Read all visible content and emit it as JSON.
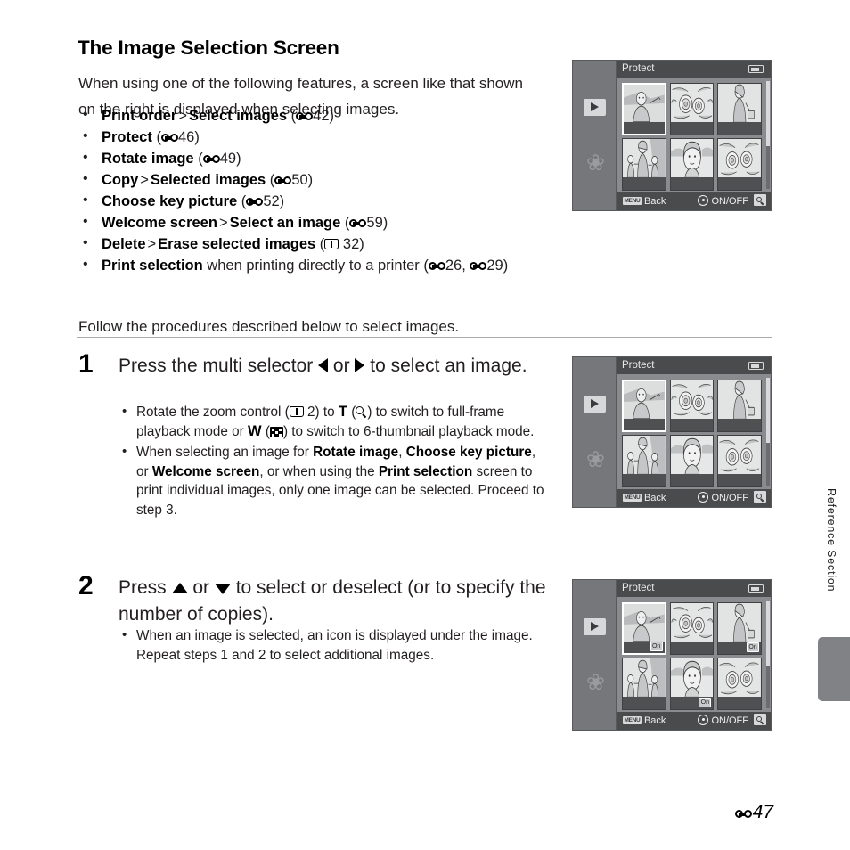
{
  "heading": "The Image Selection Screen",
  "intro": "When using one of the following features, a screen like that shown on the right is displayed when selecting images.",
  "bullets": [
    {
      "bold1": "Print order",
      "sep": ">",
      "bold2": "Select images",
      "ref_icon": "dumbbell-icon",
      "ref": "42"
    },
    {
      "bold1": "Protect",
      "sep": "",
      "bold2": "",
      "ref_icon": "dumbbell-icon",
      "ref": "46"
    },
    {
      "bold1": "Rotate image",
      "sep": "",
      "bold2": "",
      "ref_icon": "dumbbell-icon",
      "ref": "49"
    },
    {
      "bold1": "Copy",
      "sep": ">",
      "bold2": "Selected images",
      "ref_icon": "dumbbell-icon",
      "ref": "50"
    },
    {
      "bold1": "Choose key picture",
      "sep": "",
      "bold2": "",
      "ref_icon": "dumbbell-icon",
      "ref": "52"
    },
    {
      "bold1": "Welcome screen",
      "sep": ">",
      "bold2": "Select an image",
      "ref_icon": "dumbbell-icon",
      "ref": "59"
    },
    {
      "bold1": "Delete",
      "sep": ">",
      "bold2": "Erase selected images",
      "ref_icon": "book-icon",
      "ref": "32"
    },
    {
      "bold1": "Print selection",
      "sep": "",
      "bold2": "",
      "tail": "when printing directly to a printer",
      "ref_icon": "dumbbell-icon",
      "ref": "26",
      "ref2_icon": "dumbbell-icon",
      "ref2": "29"
    }
  ],
  "follow_text": "Follow the procedures described below to select images.",
  "steps": [
    {
      "number": "1",
      "title_a": "Press the multi selector ",
      "title_b": " or ",
      "title_c": " to select an image.",
      "notes": [
        {
          "a": "Rotate the zoom control (",
          "page_ref": " 2) to ",
          "t_letter": "T",
          "b": " (",
          "c": ") to switch to full-frame playback mode or ",
          "w_letter": "W",
          "d": " (",
          "e": ") to switch to 6-thumbnail playback mode."
        },
        {
          "a": "When selecting an image for ",
          "bold1": "Rotate image",
          "b": ", ",
          "bold2": "Choose key picture",
          "c": ", or ",
          "bold3": "Welcome screen",
          "d": ", or when using the ",
          "bold4": "Print selection",
          "e": " screen to print individual images, only one image can be selected. Proceed to step 3."
        }
      ]
    },
    {
      "number": "2",
      "title_a": "Press ",
      "title_b": " or ",
      "title_c": " to select or deselect (or to specify the number of copies).",
      "notes": [
        {
          "a": "When an image is selected, an icon is displayed under the image. Repeat steps 1 and 2 to select additional images."
        }
      ]
    }
  ],
  "lcd": {
    "title": "Protect",
    "back_chip": "MENU",
    "back_label": "Back",
    "onoff_label": "ON/OFF",
    "thumbnails": [
      {
        "subject": "woman-portrait-outdoors",
        "selected": true,
        "badge": ""
      },
      {
        "subject": "roses-flowers",
        "selected": false,
        "badge": ""
      },
      {
        "subject": "woman-standing-with-bag",
        "selected": false,
        "badge": ""
      },
      {
        "subject": "family-group",
        "selected": false,
        "badge": ""
      },
      {
        "subject": "woman-closeup",
        "selected": false,
        "badge": ""
      },
      {
        "subject": "roses-flowers-2",
        "selected": false,
        "badge": ""
      }
    ],
    "thumbnails_marked": [
      {
        "subject": "woman-portrait-outdoors",
        "selected": true,
        "badge": "On"
      },
      {
        "subject": "roses-flowers",
        "selected": false,
        "badge": ""
      },
      {
        "subject": "woman-standing-with-bag",
        "selected": false,
        "badge": "On"
      },
      {
        "subject": "family-group",
        "selected": false,
        "badge": ""
      },
      {
        "subject": "woman-closeup",
        "selected": false,
        "badge": "On"
      },
      {
        "subject": "roses-flowers-2",
        "selected": false,
        "badge": ""
      }
    ]
  },
  "side_label": "Reference Section",
  "page_number": "47",
  "colors": {
    "rule": "#a7a9ac",
    "lcd_bezel": "#6d6e70",
    "lcd_bar": "#4a4b4d",
    "tab_gray": "#808285"
  }
}
